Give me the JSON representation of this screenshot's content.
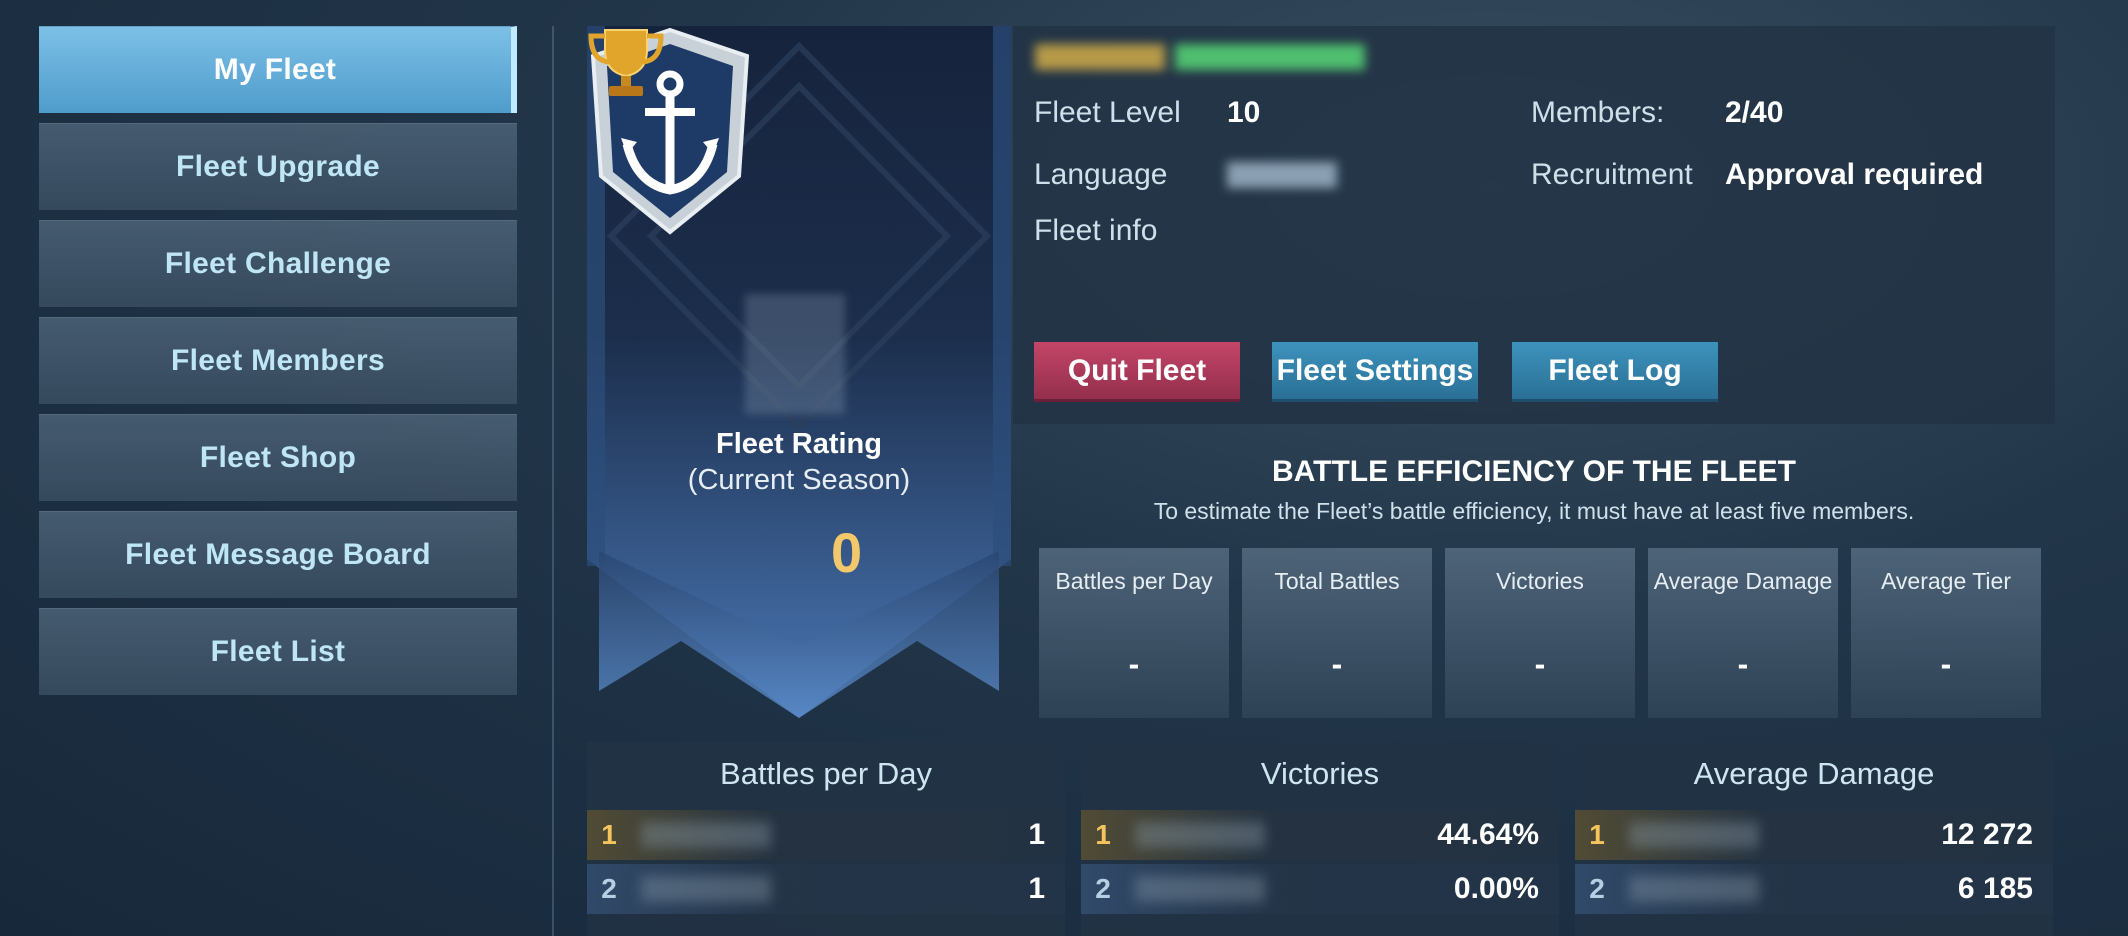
{
  "sidebar": {
    "items": [
      {
        "label": "My Fleet",
        "active": true
      },
      {
        "label": "Fleet Upgrade"
      },
      {
        "label": "Fleet Challenge"
      },
      {
        "label": "Fleet Members"
      },
      {
        "label": "Fleet Shop"
      },
      {
        "label": "Fleet Message Board"
      },
      {
        "label": "Fleet List"
      }
    ]
  },
  "banner": {
    "emblem_icon": "anchor-shield-icon",
    "rating_title": "Fleet Rating",
    "rating_subtitle": "(Current Season)",
    "trophy_icon": "trophy-icon",
    "rating_value": "0"
  },
  "fleet_info": {
    "level_label": "Fleet Level",
    "level_value": "10",
    "members_label": "Members:",
    "members_value": "2/40",
    "language_label": "Language",
    "recruitment_label": "Recruitment",
    "recruitment_value": "Approval required",
    "info_label": "Fleet info"
  },
  "buttons": {
    "quit": "Quit Fleet",
    "settings": "Fleet Settings",
    "log": "Fleet Log"
  },
  "efficiency": {
    "title": "BATTLE EFFICIENCY OF THE FLEET",
    "note": "To estimate the Fleet’s battle efficiency, it must have at least five members.",
    "cards": [
      {
        "label": "Battles per Day",
        "value": "-"
      },
      {
        "label": "Total Battles",
        "value": "-"
      },
      {
        "label": "Victories",
        "value": "-"
      },
      {
        "label": "Average Damage",
        "value": "-"
      },
      {
        "label": "Average Tier",
        "value": "-"
      }
    ]
  },
  "leaderboards": [
    {
      "title": "Battles per Day",
      "rows": [
        {
          "rank": "1",
          "value": "1"
        },
        {
          "rank": "2",
          "value": "1"
        }
      ]
    },
    {
      "title": "Victories",
      "rows": [
        {
          "rank": "1",
          "value": "44.64%"
        },
        {
          "rank": "2",
          "value": "0.00%"
        }
      ]
    },
    {
      "title": "Average Damage",
      "rows": [
        {
          "rank": "1",
          "value": "12 272"
        },
        {
          "rank": "2",
          "value": "6 185"
        }
      ]
    }
  ],
  "colors": {
    "accent_active": "#5ba8d6",
    "quit_button": "#b23d5e",
    "action_button": "#3484ad",
    "rating_gold": "#f2c86a"
  }
}
